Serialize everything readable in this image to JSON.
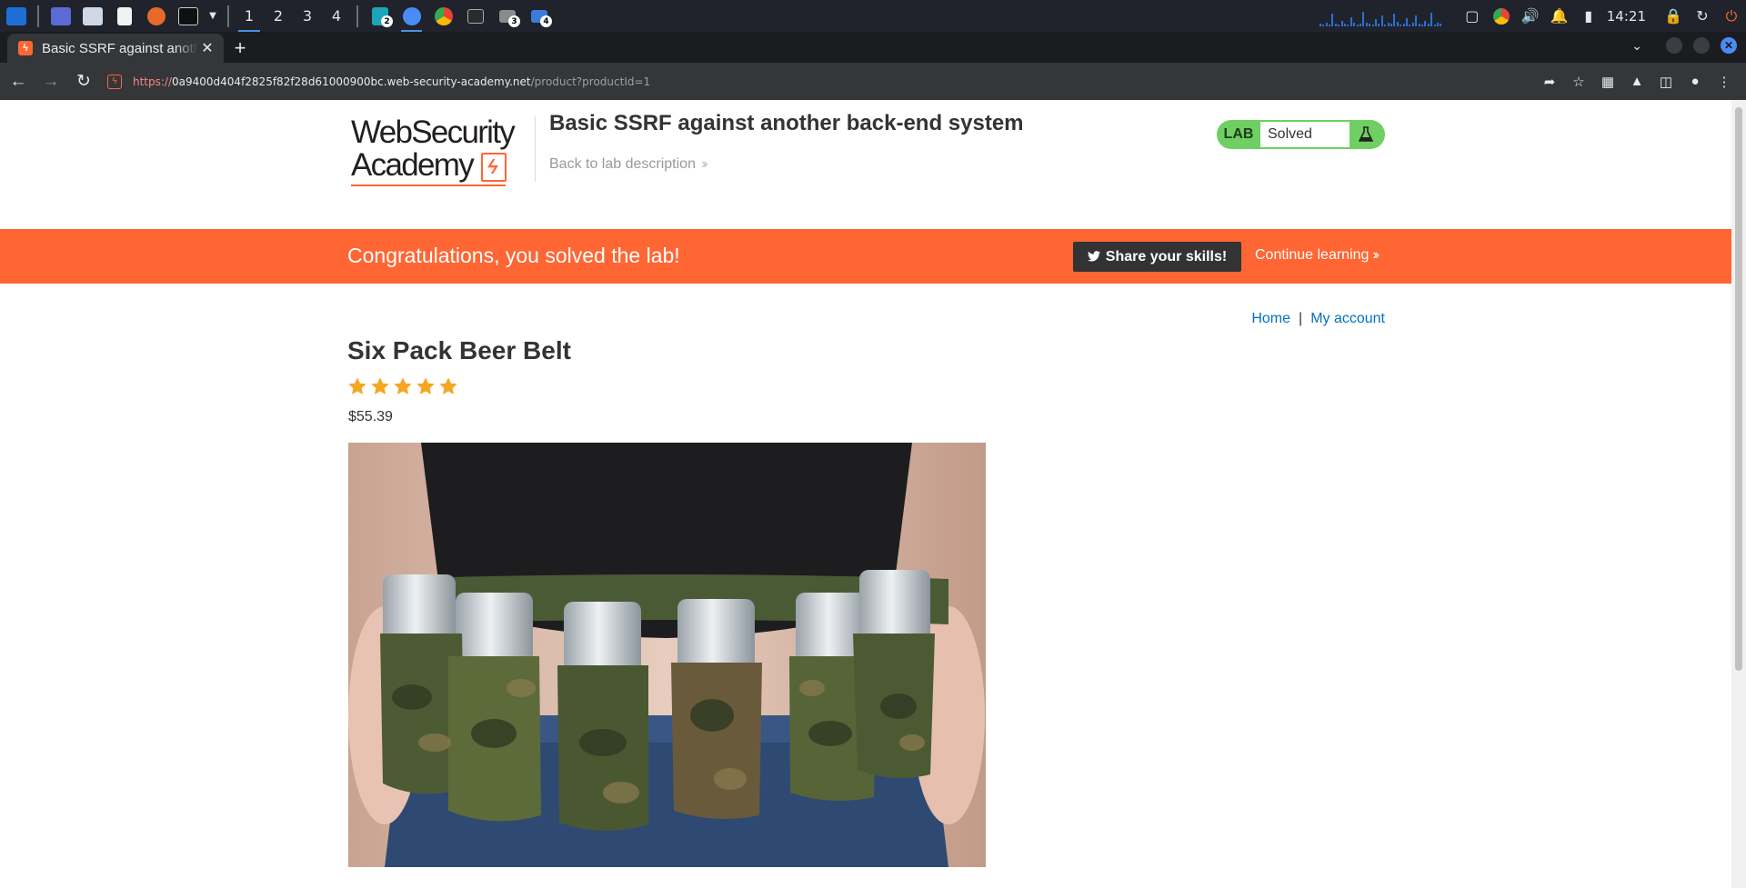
{
  "taskbar": {
    "workspaces": [
      "1",
      "2",
      "3",
      "4"
    ],
    "active_workspace": "1",
    "app_badges": {
      "kali": "2",
      "files": "3",
      "network": "4"
    },
    "clock": "14:21"
  },
  "browser": {
    "tab_title": "Basic SSRF against another back-end system",
    "url_scheme": "https://",
    "url_host": "0a9400d404f2825f82f28d61000900bc.web-security-academy.net",
    "url_path": "/product?productId=1"
  },
  "header": {
    "logo_line1": "WebSecurity",
    "logo_line2": "Academy",
    "logo_mark": "ϟ",
    "lab_title": "Basic SSRF against another back-end system",
    "back_link": "Back to lab description",
    "lab_badge": "LAB",
    "lab_status": "Solved"
  },
  "banner": {
    "message": "Congratulations, you solved the lab!",
    "share_label": "Share your skills!",
    "continue_label": "Continue learning"
  },
  "nav": {
    "home": "Home",
    "separator": "|",
    "account": "My account"
  },
  "product": {
    "name": "Six Pack Beer Belt",
    "rating": 5,
    "rating_max": 5,
    "price": "$55.39"
  },
  "colors": {
    "brand_orange": "#ff6633",
    "lab_green": "#6fcf62",
    "link_blue": "#0071bc",
    "star_gold": "#f5a623"
  }
}
